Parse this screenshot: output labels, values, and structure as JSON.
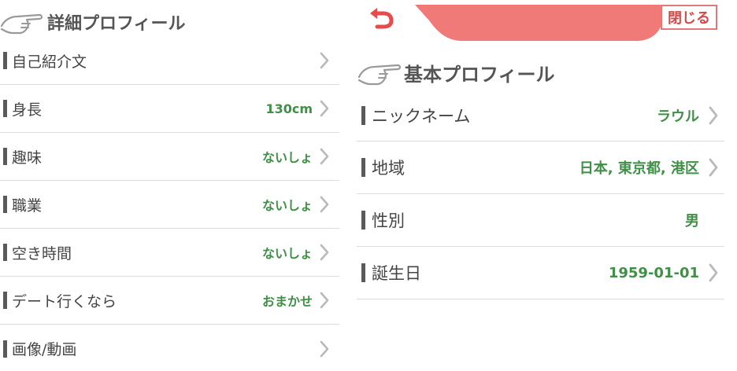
{
  "detail_profile": {
    "title": "詳細プロフィール",
    "rows": [
      {
        "label": "自己紹介文",
        "value": ""
      },
      {
        "label": "身長",
        "value": "130cm"
      },
      {
        "label": "趣味",
        "value": "ないしょ"
      },
      {
        "label": "職業",
        "value": "ないしょ"
      },
      {
        "label": "空き時間",
        "value": "ないしょ"
      },
      {
        "label": "デート行くなら",
        "value": "おまかせ"
      },
      {
        "label": "画像/動画",
        "value": ""
      }
    ]
  },
  "top_bar": {
    "close_label": "閉じる"
  },
  "basic_profile": {
    "title": "基本プロフィール",
    "rows": [
      {
        "label": "ニックネーム",
        "value": "ラウル",
        "has_chevron": true
      },
      {
        "label": "地域",
        "value": "日本, 東京都, 港区",
        "has_chevron": true
      },
      {
        "label": "性別",
        "value": "男",
        "has_chevron": false
      },
      {
        "label": "誕生日",
        "value": "1959-01-01",
        "has_chevron": true
      }
    ]
  },
  "colors": {
    "accent_red": "#ef7a78",
    "value_green": "#3f8f46",
    "label_gray": "#444444",
    "divider": "#dcdcdc"
  },
  "icons": {
    "back": "back-arrow-icon",
    "pointer": "pointing-hand-icon",
    "chevron": "chevron-right-icon"
  }
}
